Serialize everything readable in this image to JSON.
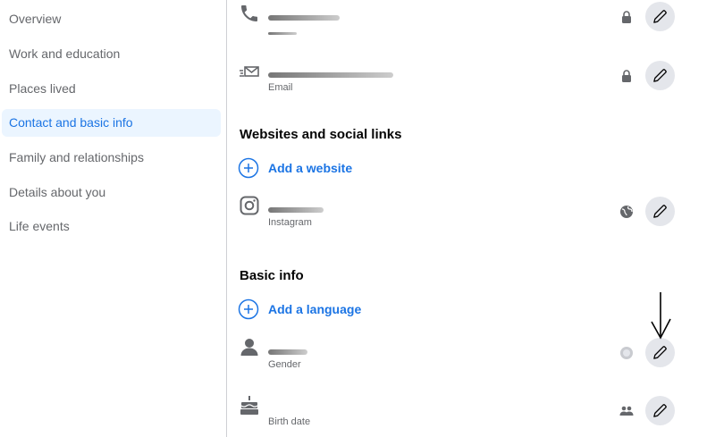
{
  "sidebar": {
    "items": [
      {
        "label": "Overview",
        "active": false
      },
      {
        "label": "Work and education",
        "active": false
      },
      {
        "label": "Places lived",
        "active": false
      },
      {
        "label": "Contact and basic info",
        "active": true
      },
      {
        "label": "Family and relationships",
        "active": false
      },
      {
        "label": "Details about you",
        "active": false
      },
      {
        "label": "Life events",
        "active": false
      }
    ]
  },
  "contact": {
    "phone": {
      "icon": "phone-icon",
      "audience_icon": "lock-icon"
    },
    "email": {
      "sub": "Email",
      "icon": "envelope-icon",
      "audience_icon": "lock-icon"
    }
  },
  "websites": {
    "title": "Websites and social links",
    "add_label": "Add a website",
    "instagram": {
      "sub": "Instagram",
      "icon": "instagram-icon",
      "audience_icon": "globe-icon"
    }
  },
  "basic_info": {
    "title": "Basic info",
    "add_label": "Add a language",
    "gender": {
      "sub": "Gender",
      "icon": "person-icon",
      "audience_icon": "globe-icon"
    },
    "birth_date": {
      "sub": "Birth date",
      "icon": "cake-icon",
      "audience_icon": "friends-icon"
    }
  },
  "colors": {
    "accent": "#1b74e4",
    "active_bg": "#ebf5ff",
    "muted_text": "#65676b",
    "button_bg": "#e4e6eb"
  }
}
